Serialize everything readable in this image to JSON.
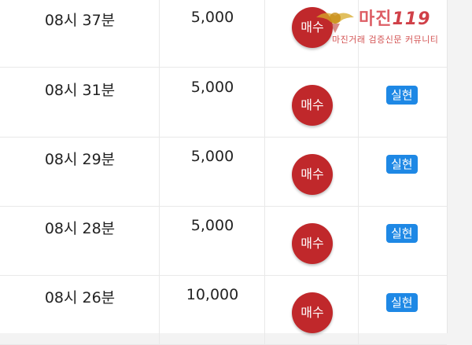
{
  "trades": [
    {
      "time": "08시 37분",
      "amount": "5,000",
      "type": "매수",
      "status": ""
    },
    {
      "time": "08시 31분",
      "amount": "5,000",
      "type": "매수",
      "status": "실현"
    },
    {
      "time": "08시 29분",
      "amount": "5,000",
      "type": "매수",
      "status": "실현"
    },
    {
      "time": "08시 28분",
      "amount": "5,000",
      "type": "매수",
      "status": "실현"
    },
    {
      "time": "08시 26분",
      "amount": "10,000",
      "type": "매수",
      "status": "실현"
    }
  ],
  "watermark": {
    "title_main": "마진",
    "title_suffix": "119",
    "subtitle": "마진거래 검증신문 커뮤니티"
  },
  "colors": {
    "buy": "#c0282b",
    "realized": "#1e88e5"
  }
}
